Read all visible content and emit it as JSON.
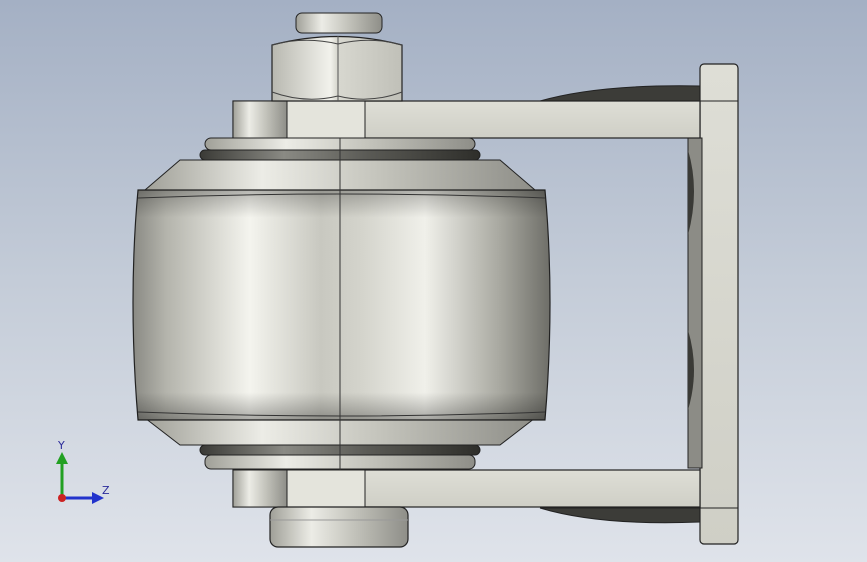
{
  "viewport": {
    "background_top": "#a4b0c4",
    "background_bottom": "#dfe3ea"
  },
  "model": {
    "part_color": "#d6d6ce",
    "roller_color": "#c8c8c0",
    "edge_color": "#222222"
  },
  "triad": {
    "y_label": "Y",
    "z_label": "Z",
    "y_color": "#22a022",
    "z_color": "#2233cc",
    "x_color": "#cc2222"
  }
}
